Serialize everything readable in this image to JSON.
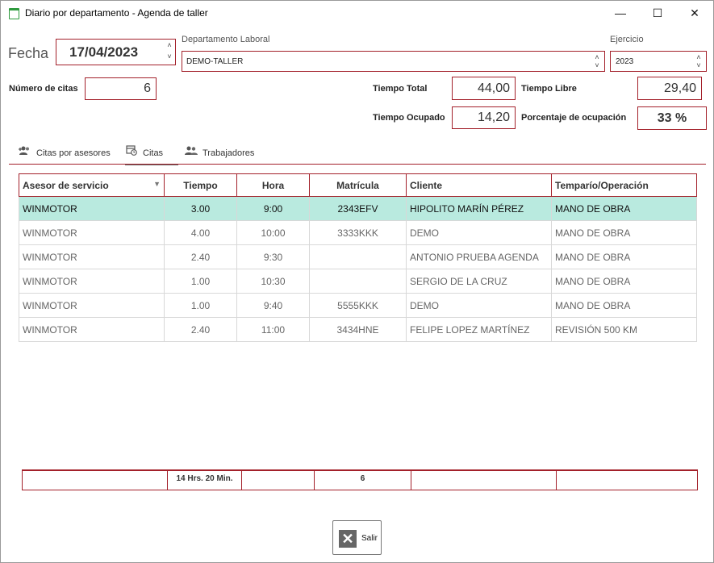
{
  "window": {
    "title": "Diario por departamento - Agenda de taller",
    "minimize_glyph": "—",
    "maximize_glyph": "☐",
    "close_glyph": "✕"
  },
  "form": {
    "fecha_label": "Fecha",
    "fecha_value": "17/04/2023",
    "departamento_label": "Departamento Laboral",
    "departamento_value": "DEMO-TALLER",
    "ejercicio_label": "Ejercicio",
    "ejercicio_value": "2023",
    "num_citas_label": "Número de citas",
    "num_citas_value": "6",
    "tiempo_total_label": "Tiempo Total",
    "tiempo_total_value": "44,00",
    "tiempo_libre_label": "Tiempo Libre",
    "tiempo_libre_value": "29,40",
    "tiempo_ocupado_label": "Tiempo Ocupado",
    "tiempo_ocupado_value": "14,20",
    "porcentaje_label": "Porcentaje de ocupación",
    "porcentaje_value": "33 %"
  },
  "tabs": [
    {
      "label": "Citas por asesores",
      "icon": "add-group-icon"
    },
    {
      "label": "Citas",
      "icon": "calendar-clock-icon"
    },
    {
      "label": "Trabajadores",
      "icon": "people-icon"
    }
  ],
  "table": {
    "headers": [
      "Asesor de servicio",
      "Tiempo",
      "Hora",
      "Matrícula",
      "Cliente",
      "Temparío/Operación"
    ],
    "rows": [
      [
        "WINMOTOR",
        "3.00",
        "9:00",
        "2343EFV",
        "HIPOLITO MARÍN PÉREZ",
        "MANO DE OBRA"
      ],
      [
        "WINMOTOR",
        "4.00",
        "10:00",
        "3333KKK",
        "DEMO",
        "MANO DE OBRA"
      ],
      [
        "WINMOTOR",
        "2.40",
        "9:30",
        "",
        "ANTONIO PRUEBA AGENDA",
        "MANO DE OBRA"
      ],
      [
        "WINMOTOR",
        "1.00",
        "10:30",
        "",
        "SERGIO DE LA CRUZ",
        "MANO DE OBRA"
      ],
      [
        "WINMOTOR",
        "1.00",
        "9:40",
        "5555KKK",
        "DEMO",
        "MANO DE OBRA"
      ],
      [
        "WINMOTOR",
        "2.40",
        "11:00",
        "3434HNE",
        "FELIPE LOPEZ MARTÍNEZ",
        "REVISIÓN 500 KM"
      ]
    ],
    "selected_row": 0
  },
  "footer": {
    "tiempo_total": "14 Hrs. 20 Min.",
    "count": "6"
  },
  "salir_label": "Salir",
  "colors": {
    "accent": "#a3202a",
    "selected_row": "#b9eadf"
  }
}
